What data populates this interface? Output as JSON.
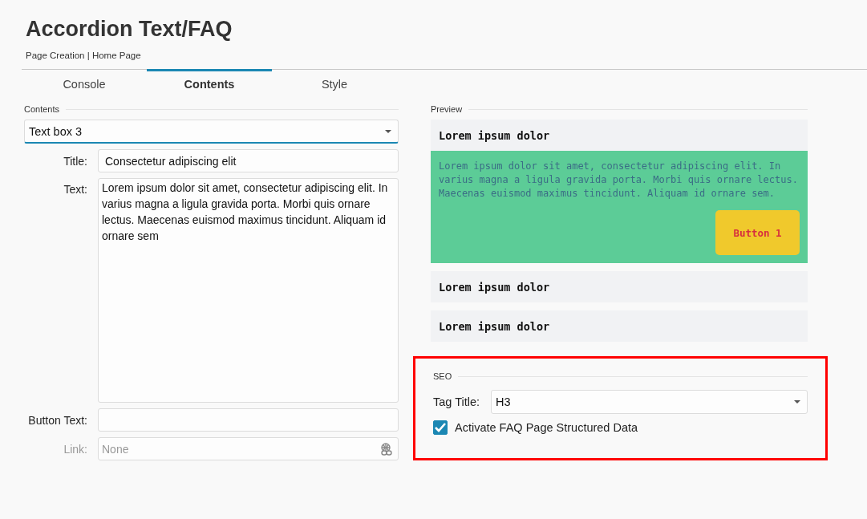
{
  "page": {
    "title": "Accordion Text/FAQ",
    "breadcrumb": "Page Creation | Home Page"
  },
  "tabs": [
    {
      "label": "Console",
      "selected": false
    },
    {
      "label": "Contents",
      "selected": true
    },
    {
      "label": "Style",
      "selected": false
    }
  ],
  "contents": {
    "section_label": "Contents",
    "selector": {
      "value": "Text box 3"
    },
    "fields": [
      {
        "kind": "text",
        "label": "Title:",
        "value": "Consectetur adipiscing elit",
        "disabled": false
      },
      {
        "kind": "textarea",
        "label": "Text:",
        "value": "Lorem ipsum dolor sit amet, consectetur adipiscing elit. In varius magna a ligula gravida porta. Morbi quis ornare lectus. Maecenas euismod maximus tincidunt. Aliquam id ornare sem",
        "disabled": false
      },
      {
        "kind": "text",
        "label": "Button Text:",
        "disabled": false
      },
      {
        "kind": "link",
        "label": "Link:",
        "placeholder": "None",
        "disabled": true
      }
    ]
  },
  "preview": {
    "section_label": "Preview",
    "items": [
      {
        "title": "Lorem ipsum dolor",
        "expanded": true,
        "body": "Lorem ipsum dolor sit amet, consectetur adipiscing elit. In varius magna a ligula gravida porta. Morbi quis ornare lectus. Maecenas euismod maximus tincidunt. Aliquam id ornare sem.",
        "button": "Button 1"
      },
      {
        "title": "Lorem ipsum dolor",
        "expanded": false
      },
      {
        "title": "Lorem ipsum dolor",
        "expanded": false
      }
    ]
  },
  "seo": {
    "section_label": "SEO",
    "highlighted": true,
    "tag_title": {
      "label": "Tag Title:",
      "value": "H3"
    },
    "structured_data": {
      "label": "Activate FAQ Page Structured Data",
      "checked": true
    }
  }
}
